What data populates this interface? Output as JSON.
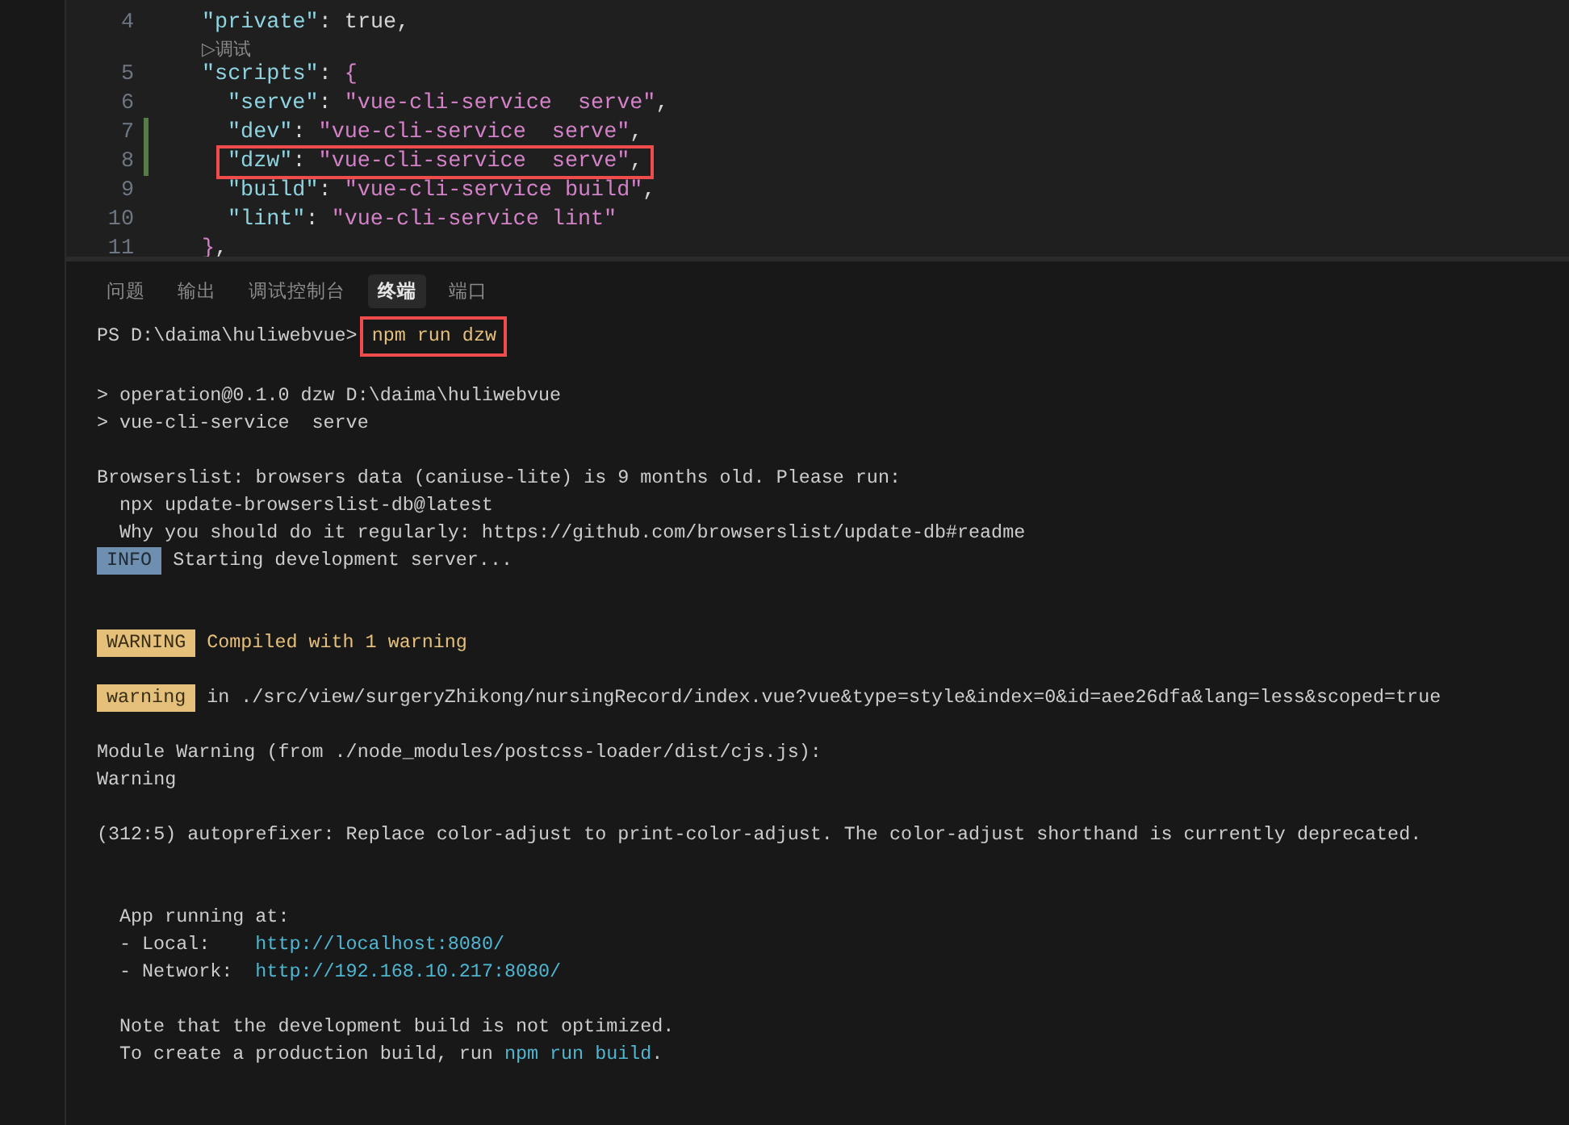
{
  "editor": {
    "lines": [
      {
        "number": "4",
        "modified": false,
        "highlighted": false,
        "tokens": [
          {
            "text": "\"private\"",
            "kind": "key"
          },
          {
            "text": ":",
            "kind": "punct"
          },
          {
            "text": "true,",
            "kind": "plain"
          }
        ]
      },
      {
        "number": "5",
        "modified": false,
        "highlighted": false,
        "codelens": "▷调试",
        "tokens": [
          {
            "text": "\"scripts\"",
            "kind": "key"
          },
          {
            "text": ":",
            "kind": "punct"
          },
          {
            "text": "{",
            "kind": "brace"
          }
        ],
        "children": [
          {
            "number": "6",
            "modified": false,
            "highlighted": false,
            "tokens": [
              {
                "text": "\"serve\"",
                "kind": "key"
              },
              {
                "text": ":",
                "kind": "punct"
              },
              {
                "text": "\"vue-cli-service  serve\"",
                "kind": "string"
              },
              {
                "text": ",",
                "kind": "plain"
              }
            ]
          },
          {
            "number": "7",
            "modified": true,
            "highlighted": false,
            "tokens": [
              {
                "text": "\"dev\"",
                "kind": "key"
              },
              {
                "text": ":",
                "kind": "punct"
              },
              {
                "text": "\"vue-cli-service  serve\"",
                "kind": "string"
              },
              {
                "text": ",",
                "kind": "plain"
              }
            ]
          },
          {
            "number": "8",
            "modified": true,
            "highlighted": true,
            "tokens": [
              {
                "text": "\"dzw\"",
                "kind": "key"
              },
              {
                "text": ":",
                "kind": "punct"
              },
              {
                "text": "\"vue-cli-service  serve\"",
                "kind": "string"
              },
              {
                "text": ",",
                "kind": "plain"
              }
            ]
          },
          {
            "number": "9",
            "modified": false,
            "highlighted": false,
            "tokens": [
              {
                "text": "\"build\"",
                "kind": "key"
              },
              {
                "text": ":",
                "kind": "punct"
              },
              {
                "text": "\"vue-cli-service build\"",
                "kind": "string"
              },
              {
                "text": ",",
                "kind": "plain"
              }
            ]
          },
          {
            "number": "10",
            "modified": false,
            "highlighted": false,
            "tokens": [
              {
                "text": "\"lint\"",
                "kind": "key"
              },
              {
                "text": ":",
                "kind": "punct"
              },
              {
                "text": "\"vue-cli-service lint\"",
                "kind": "string"
              }
            ]
          }
        ]
      },
      {
        "number": "11",
        "modified": false,
        "highlighted": false,
        "tokens": [
          {
            "text": "}",
            "kind": "brace"
          },
          {
            "text": ",",
            "kind": "plain"
          }
        ]
      }
    ]
  },
  "panel": {
    "tabs": [
      {
        "label": "问题",
        "selected": false
      },
      {
        "label": "输出",
        "selected": false
      },
      {
        "label": "调试控制台",
        "selected": false
      },
      {
        "label": "终端",
        "selected": true
      },
      {
        "label": "端口",
        "selected": false
      }
    ],
    "terminal": [
      {
        "kind": "prompt",
        "prompt": "PS D:\\daima\\huliwebvue>",
        "command": "npm run dzw",
        "highlighted": true
      },
      {
        "kind": "blank"
      },
      {
        "kind": "text",
        "parts": [
          {
            "text": "> operation@0.1.0 dzw D:\\daima\\huliwebvue",
            "kind": "plain"
          }
        ]
      },
      {
        "kind": "text",
        "parts": [
          {
            "text": "> vue-cli-service  serve",
            "kind": "plain"
          }
        ]
      },
      {
        "kind": "blank"
      },
      {
        "kind": "text",
        "parts": [
          {
            "text": "Browserslist: browsers data (caniuse-lite) is 9 months old. Please run:",
            "kind": "plain"
          }
        ]
      },
      {
        "kind": "indented",
        "parts": [
          {
            "text": "npx update-browserslist-db@latest",
            "kind": "plain"
          }
        ]
      },
      {
        "kind": "indented",
        "parts": [
          {
            "text": "Why you should do it regularly: https://github.com/browserslist/update-db#readme",
            "kind": "plain"
          }
        ]
      },
      {
        "kind": "info",
        "badge": "INFO",
        "message": "Starting development server..."
      },
      {
        "kind": "blank"
      },
      {
        "kind": "blank"
      },
      {
        "kind": "warning-title",
        "badge": "WARNING",
        "message": "Compiled with 1 warning"
      },
      {
        "kind": "blank"
      },
      {
        "kind": "warning-detail",
        "badge": "warning",
        "message": "in ./src/view/surgeryZhikong/nursingRecord/index.vue?vue&type=style&index=0&id=aee26dfa&lang=less&scoped=true"
      },
      {
        "kind": "blank"
      },
      {
        "kind": "text",
        "parts": [
          {
            "text": "Module Warning (from ./node_modules/postcss-loader/dist/cjs.js):",
            "kind": "plain"
          }
        ]
      },
      {
        "kind": "text",
        "parts": [
          {
            "text": "Warning",
            "kind": "plain"
          }
        ]
      },
      {
        "kind": "blank"
      },
      {
        "kind": "text",
        "parts": [
          {
            "text": "(312:5) autoprefixer: Replace color-adjust to print-color-adjust. The color-adjust shorthand is currently deprecated.",
            "kind": "plain"
          }
        ]
      },
      {
        "kind": "blank"
      },
      {
        "kind": "blank"
      },
      {
        "kind": "indented",
        "parts": [
          {
            "text": "App running at:",
            "kind": "plain"
          }
        ]
      },
      {
        "kind": "indented",
        "parts": [
          {
            "text": "- Local:",
            "kind": "plain"
          },
          {
            "text": "http://localhost:8080/",
            "kind": "link"
          }
        ]
      },
      {
        "kind": "indented",
        "parts": [
          {
            "text": "- Network:",
            "kind": "plain"
          },
          {
            "text": "http://192.168.10.217:8080/",
            "kind": "link"
          }
        ]
      },
      {
        "kind": "blank"
      },
      {
        "kind": "indented",
        "parts": [
          {
            "text": "Note that the development build is not optimized.",
            "kind": "plain"
          }
        ]
      },
      {
        "kind": "indented",
        "parts": [
          {
            "text": "To create a production build, run",
            "kind": "plain"
          },
          {
            "text": "npm run build",
            "kind": "link"
          },
          {
            "text": ".",
            "kind": "dot"
          }
        ]
      }
    ]
  }
}
